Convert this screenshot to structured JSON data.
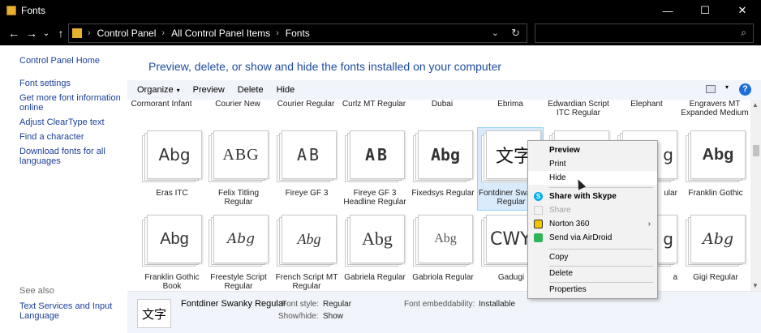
{
  "window": {
    "title": "Fonts",
    "controls": [
      "—",
      "☐",
      "✕"
    ]
  },
  "nav": {
    "back": "←",
    "forward": "→",
    "recent": "⌄",
    "up": "↑"
  },
  "address": {
    "crumbs": [
      "Control Panel",
      "All Control Panel Items",
      "Fonts"
    ],
    "separator": "›",
    "dropdown": "⌄",
    "refresh": "↻"
  },
  "search": {
    "value": "",
    "placeholder": "",
    "icon": "⌕"
  },
  "left_pane": {
    "home": "Control Panel Home",
    "links": [
      "Font settings",
      "Get more font information online",
      "Adjust ClearType text",
      "Find a character",
      "Download fonts for all languages"
    ],
    "see_also": "See also",
    "see_also_links": [
      "Text Services and Input Language"
    ]
  },
  "main": {
    "title": "Preview, delete, or show and hide the fonts installed on your computer"
  },
  "toolbar": {
    "organize": "Organize",
    "organize_arrow": "▾",
    "preview": "Preview",
    "delete": "Delete",
    "hide": "Hide",
    "view_arrow": "▾",
    "help": "?"
  },
  "partial_names": [
    "Cormorant Infant",
    "Courier New",
    "Courier Regular",
    "Curlz MT Regular",
    "Dubai",
    "Ebrima",
    "Edwardian Script ITC Regular",
    "Elephant",
    "Engravers MT Expanded Medium"
  ],
  "row1": [
    {
      "name": "Eras ITC",
      "sample": "Abg"
    },
    {
      "name": "Felix Titling Regular",
      "sample": "ABG"
    },
    {
      "name": "Fireye GF 3",
      "sample": "AB"
    },
    {
      "name": "Fireye GF 3 Headline Regular",
      "sample": "AB"
    },
    {
      "name": "Fixedsys Regular",
      "sample": "Abg"
    },
    {
      "name": "Fontdiner Swanky Regular",
      "sample": "文字"
    },
    {
      "name": "",
      "sample": ""
    },
    {
      "name": "ular",
      "sample": "g"
    },
    {
      "name": "Franklin Gothic",
      "sample": "Abg"
    }
  ],
  "row2": [
    {
      "name": "Franklin Gothic Book",
      "sample": "Abg"
    },
    {
      "name": "Freestyle Script Regular",
      "sample": "Abg"
    },
    {
      "name": "French Script MT Regular",
      "sample": "Abg"
    },
    {
      "name": "Gabriela Regular",
      "sample": "Abg"
    },
    {
      "name": "Gabriola Regular",
      "sample": "Abg"
    },
    {
      "name": "Gadugi",
      "sample": "CWY"
    },
    {
      "name": "",
      "sample": ""
    },
    {
      "name": "a",
      "sample": "g"
    },
    {
      "name": "Gigi Regular",
      "sample": "Abg"
    }
  ],
  "details": {
    "icon_text": "文字",
    "font_name": "Fontdiner Swanky Regular",
    "style_label": "Font style:",
    "style_value": "Regular",
    "showhide_label": "Show/hide:",
    "showhide_value": "Show",
    "embed_label": "Font embeddability:",
    "embed_value": "Installable"
  },
  "context_menu": {
    "preview": "Preview",
    "print": "Print",
    "hide": "Hide",
    "skype": "Share with Skype",
    "share": "Share",
    "norton": "Norton 360",
    "airdroid": "Send via AirDroid",
    "copy": "Copy",
    "delete": "Delete",
    "properties": "Properties",
    "submenu_arrow": "›"
  },
  "scrollbar": {
    "up": "▲",
    "down": "▼"
  },
  "colors": {
    "link": "#1a3f99",
    "title": "#1e4b9e",
    "selection": "#d9ebfb",
    "toolbar_bg": "#f1f4fa"
  }
}
